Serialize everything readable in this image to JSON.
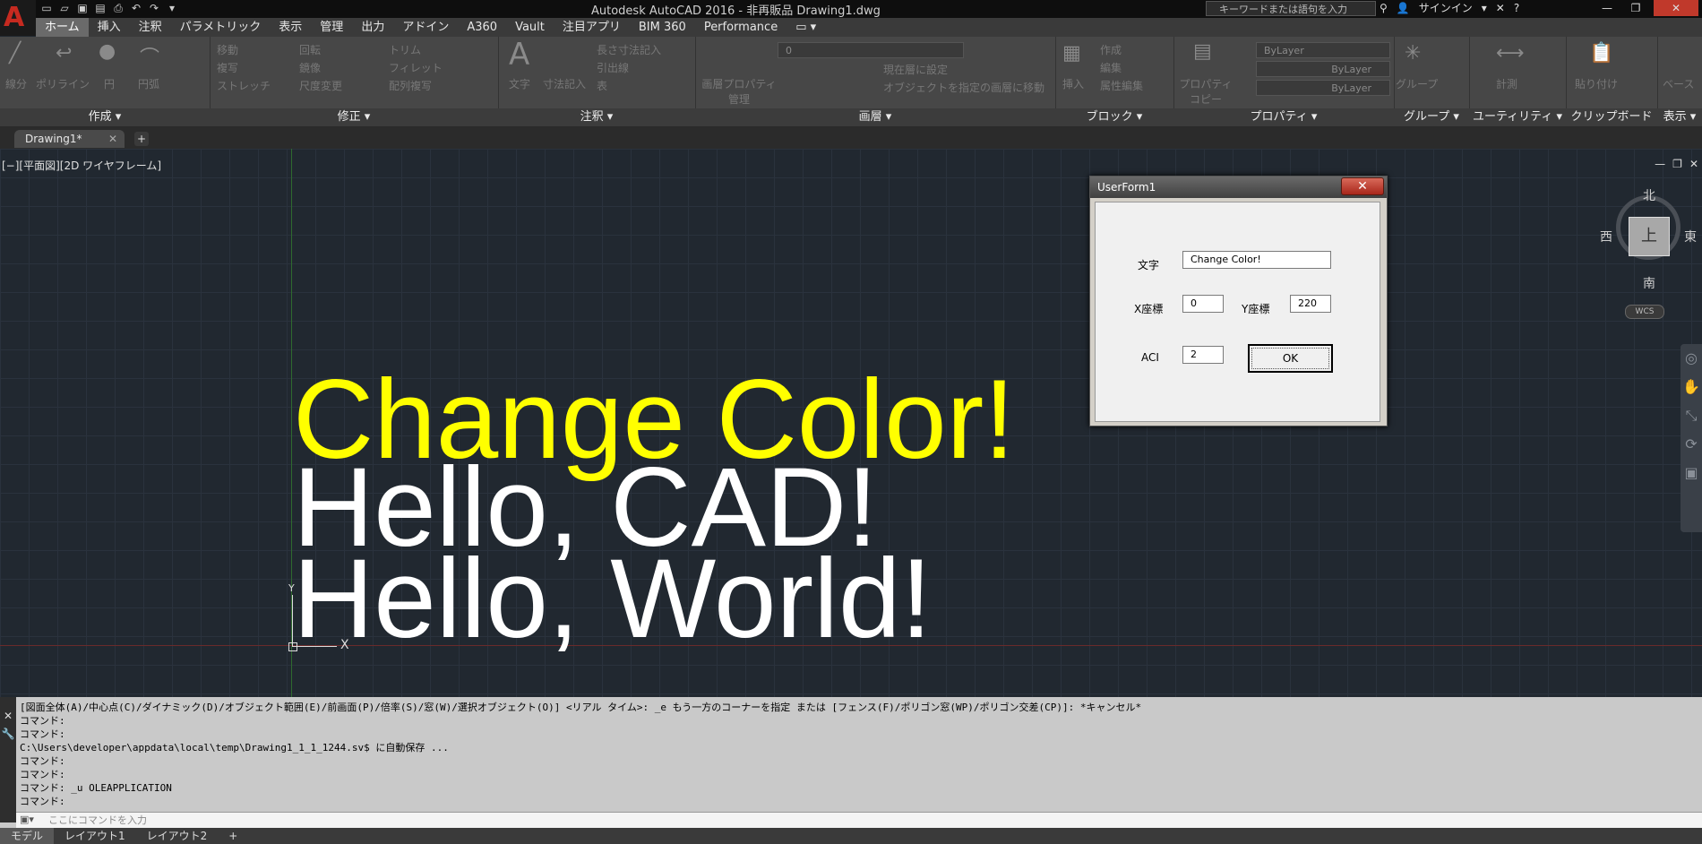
{
  "title_bar": {
    "window_title": "Autodesk AutoCAD 2016 - 非再販品    Drawing1.dwg",
    "search_placeholder": "キーワードまたは語句を入力",
    "signin_label": "サインイン",
    "qat_icons": [
      "new-icon",
      "open-icon",
      "save-icon",
      "saveas-icon",
      "plot-icon",
      "undo-icon",
      "redo-icon"
    ]
  },
  "menu_tabs": [
    "ホーム",
    "挿入",
    "注釈",
    "パラメトリック",
    "表示",
    "管理",
    "出力",
    "アドイン",
    "A360",
    "Vault",
    "注目アプリ",
    "BIM 360",
    "Performance"
  ],
  "ribbon": {
    "draw": {
      "title": "作成 ▾",
      "items": [
        "線分",
        "ポリライン",
        "円",
        "円弧"
      ]
    },
    "modify": {
      "title": "修正 ▾",
      "items": [
        "移動",
        "回転",
        "トリム",
        "複写",
        "鏡像",
        "フィレット",
        "ストレッチ",
        "尺度変更",
        "配列複写"
      ]
    },
    "annotation": {
      "title": "注釈 ▾",
      "items": [
        "文字",
        "寸法記入",
        "長さ寸法記入",
        "引出線",
        "表"
      ]
    },
    "layers": {
      "title": "画層 ▾",
      "items": [
        "画層プロパティ管理",
        "現在層に設定",
        "オブジェクトを指定の画層に移動"
      ],
      "current_layer": "0"
    },
    "block": {
      "title": "ブロック ▾",
      "items": [
        "挿入",
        "作成",
        "編集",
        "属性編集"
      ]
    },
    "properties": {
      "title": "プロパティ ▾",
      "items": [
        "プロパティコピー"
      ],
      "color": "ByLayer",
      "linetype": "ByLayer",
      "lineweight": "ByLayer"
    },
    "groups": {
      "title": "グループ ▾",
      "items": [
        "グループ"
      ]
    },
    "utilities": {
      "title": "ユーティリティ ▾",
      "items": [
        "計測"
      ]
    },
    "clipboard": {
      "title": "クリップボード",
      "items": [
        "貼り付け"
      ]
    },
    "view": {
      "title": "表示 ▾",
      "items": [
        "ベース"
      ]
    }
  },
  "doc_tab": {
    "label": "Drawing1*"
  },
  "viewport": {
    "label": "[−][平面図][2D ワイヤフレーム]",
    "drawing_texts": [
      {
        "text": "Change Color!",
        "color": "#ffff00"
      },
      {
        "text": "Hello, CAD!",
        "color": "#ffffff"
      },
      {
        "text": "Hello, World!",
        "color": "#ffffff"
      }
    ],
    "compass": {
      "north": "北",
      "south": "南",
      "east": "東",
      "west": "西",
      "top": "上",
      "wcs": "WCS"
    },
    "ucs": {
      "x": "X",
      "y": "Y"
    }
  },
  "userform": {
    "title": "UserForm1",
    "close_label": "✕",
    "text_label": "文字",
    "text_value": "Change Color!",
    "x_label": "X座標",
    "x_value": "0",
    "y_label": "Y座標",
    "y_value": "220",
    "aci_label": "ACI",
    "aci_value": "2",
    "ok_label": "OK"
  },
  "command_history": [
    "[図面全体(A)/中心点(C)/ダイナミック(D)/オブジェクト範囲(E)/前画面(P)/倍率(S)/窓(W)/選択オブジェクト(O)] <リアル タイム>: _e もう一方のコーナーを指定 または [フェンス(F)/ポリゴン窓(WP)/ポリゴン交差(CP)]: *キャンセル*",
    "コマンド:",
    "コマンド:",
    "C:\\Users\\developer\\appdata\\local\\temp\\Drawing1_1_1_1244.sv$ に自動保存 ...",
    "コマンド:",
    "コマンド:",
    "コマンド: _u OLEAPPLICATION",
    "コマンド:"
  ],
  "command_input_placeholder": "ここにコマンドを入力",
  "status_tabs": [
    "モデル",
    "レイアウト1",
    "レイアウト2",
    "+"
  ]
}
